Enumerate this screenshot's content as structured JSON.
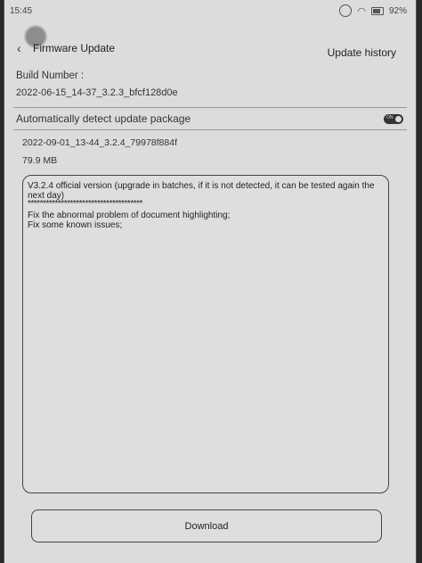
{
  "status_bar": {
    "time": "15:45",
    "battery": "92%",
    "icons": [
      "sync-icon",
      "wifi-icon",
      "battery-icon"
    ]
  },
  "header": {
    "title": "Firmware Update",
    "history_link": "Update history"
  },
  "build": {
    "label": "Build Number :",
    "value": "2022-06-15_14-37_3.2.3_bfcf128d0e"
  },
  "auto_detect": {
    "label": "Automatically detect update package",
    "toggle_text": "ON",
    "enabled": true
  },
  "package": {
    "name": "2022-09-01_13-44_3.2.4_79978f884f",
    "size": "79.9 MB"
  },
  "release_notes": {
    "line1": "V3.2.4 official version (upgrade in batches, if it is not detected, it can be tested again the",
    "line2": "next day)",
    "line3": "**************************************",
    "line4": "Fix the abnormal problem of document highlighting;",
    "line5": "Fix some known issues;"
  },
  "download_button": "Download"
}
